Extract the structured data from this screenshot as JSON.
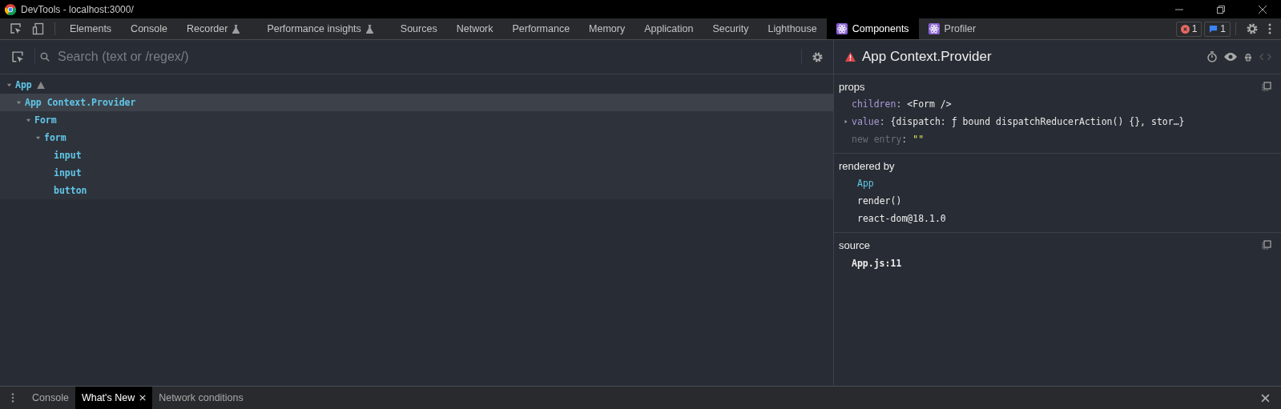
{
  "window": {
    "title": "DevTools - localhost:3000/"
  },
  "tabs": [
    {
      "label": "Elements",
      "kind": "plain",
      "selected": false
    },
    {
      "label": "Console",
      "kind": "plain",
      "selected": false
    },
    {
      "label": "Recorder",
      "kind": "flask",
      "selected": false
    },
    {
      "label": "Performance insights",
      "kind": "flask",
      "selected": false
    },
    {
      "label": "Sources",
      "kind": "plain",
      "selected": false
    },
    {
      "label": "Network",
      "kind": "plain",
      "selected": false
    },
    {
      "label": "Performance",
      "kind": "plain",
      "selected": false
    },
    {
      "label": "Memory",
      "kind": "plain",
      "selected": false
    },
    {
      "label": "Application",
      "kind": "plain",
      "selected": false
    },
    {
      "label": "Security",
      "kind": "plain",
      "selected": false
    },
    {
      "label": "Lighthouse",
      "kind": "plain",
      "selected": false
    },
    {
      "label": "Components",
      "kind": "react",
      "selected": true
    },
    {
      "label": "Profiler",
      "kind": "react",
      "selected": false
    }
  ],
  "status": {
    "errors": "1",
    "messages": "1"
  },
  "search": {
    "placeholder": "Search (text or /regex/)"
  },
  "tree": [
    {
      "label": "App",
      "warning": true,
      "selected": false,
      "expanded": true,
      "children": [
        {
          "label": "App Context.Provider",
          "selected": true,
          "expanded": true,
          "children": [
            {
              "label": "Form",
              "selected": false,
              "expanded": true,
              "children": [
                {
                  "label": "form",
                  "selected": false,
                  "expanded": true,
                  "children": [
                    {
                      "label": "input",
                      "selected": false
                    },
                    {
                      "label": "input",
                      "selected": false
                    },
                    {
                      "label": "button",
                      "selected": false
                    }
                  ]
                }
              ]
            }
          ]
        }
      ]
    }
  ],
  "inspector": {
    "title": "App Context.Provider",
    "warning": true,
    "props": {
      "heading": "props",
      "items": [
        {
          "key": "children",
          "separator": ":",
          "value": "<Form />",
          "kind": "prop"
        },
        {
          "key": "value",
          "separator": ":",
          "value": "{dispatch: ƒ bound dispatchReducerAction() {}, stor…}",
          "kind": "prop",
          "expandable": true
        },
        {
          "key": "new entry",
          "separator": ":",
          "value": "\"\"",
          "kind": "new"
        }
      ]
    },
    "rendered_by": {
      "heading": "rendered by",
      "items": [
        {
          "label": "App",
          "kind": "component"
        },
        {
          "label": "render()",
          "kind": "plain"
        },
        {
          "label": "react-dom@18.1.0",
          "kind": "plain"
        }
      ]
    },
    "source": {
      "heading": "source",
      "location": "App.js:11"
    }
  },
  "drawer": {
    "tabs": [
      {
        "label": "Console",
        "selected": false,
        "closable": false
      },
      {
        "label": "What's New",
        "selected": true,
        "closable": true
      },
      {
        "label": "Network conditions",
        "selected": false,
        "closable": false
      }
    ]
  }
}
